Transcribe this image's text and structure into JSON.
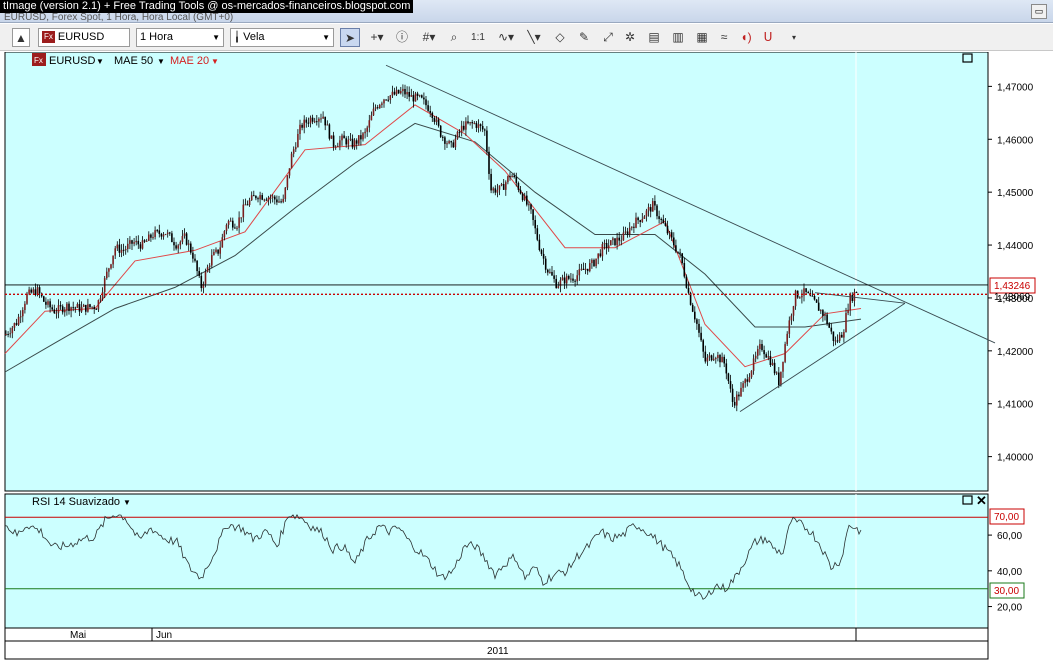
{
  "window": {
    "title": "tImage (version 2.1) + Free Trading Tools @ os-mercados-financeiros.blogspot.com",
    "subtitle": "EURUSD, Forex Spot, 1 Hora, Hora Local (GMT+0)"
  },
  "toolbar": {
    "symbol": "EURUSD",
    "interval": "1 Hora",
    "chart_type": "Vela",
    "badge": "Fx",
    "zoom_label": "1:1"
  },
  "price_panel": {
    "badge": "Fx",
    "legend": [
      {
        "label": "EURUSD",
        "color": "#000000"
      },
      {
        "label": "MAE 50",
        "color": "#000000"
      },
      {
        "label": "MAE 20",
        "color": "#d42020"
      }
    ],
    "last_price_label": "1,43246",
    "red_line_label": "1,43069",
    "colors": {
      "background": "#ccffff",
      "bull": "#7a1e1e",
      "bear": "#000000",
      "ema20": "#e04848",
      "ema50": "#3a4a4a",
      "resistance": "#c80000"
    }
  },
  "rsi_panel": {
    "title": "RSI 14 Suavizado",
    "upper_level_label": "70,00",
    "lower_level_label": "30,00"
  },
  "time_axis": {
    "months": [
      "Mai",
      "Jun"
    ],
    "year": "2011"
  },
  "chart_data": [
    {
      "type": "candlestick",
      "title": "EURUSD",
      "ylim": [
        1.3935,
        1.4765
      ],
      "yticks": [
        1.4,
        1.41,
        1.42,
        1.43,
        1.44,
        1.45,
        1.46,
        1.47
      ],
      "ytick_labels": [
        "1,40000",
        "1,41000",
        "1,42000",
        "1,43000",
        "1,44000",
        "1,45000",
        "1,46000",
        "1,47000"
      ],
      "grid": false,
      "legend_position": "top-left",
      "close_path": [
        [
          0,
          1.423
        ],
        [
          12,
          1.4255
        ],
        [
          22,
          1.4305
        ],
        [
          32,
          1.4315
        ],
        [
          40,
          1.429
        ],
        [
          50,
          1.4275
        ],
        [
          62,
          1.4285
        ],
        [
          76,
          1.428
        ],
        [
          92,
          1.4285
        ],
        [
          100,
          1.4335
        ],
        [
          110,
          1.4395
        ],
        [
          118,
          1.439
        ],
        [
          128,
          1.4405
        ],
        [
          138,
          1.44
        ],
        [
          148,
          1.442
        ],
        [
          160,
          1.4425
        ],
        [
          172,
          1.44
        ],
        [
          180,
          1.4415
        ],
        [
          188,
          1.438
        ],
        [
          196,
          1.432
        ],
        [
          206,
          1.4375
        ],
        [
          214,
          1.439
        ],
        [
          222,
          1.4445
        ],
        [
          232,
          1.444
        ],
        [
          240,
          1.4475
        ],
        [
          252,
          1.4495
        ],
        [
          266,
          1.449
        ],
        [
          278,
          1.448
        ],
        [
          286,
          1.4565
        ],
        [
          296,
          1.4625
        ],
        [
          306,
          1.464
        ],
        [
          318,
          1.4645
        ],
        [
          328,
          1.459
        ],
        [
          338,
          1.46
        ],
        [
          348,
          1.459
        ],
        [
          360,
          1.461
        ],
        [
          370,
          1.466
        ],
        [
          380,
          1.468
        ],
        [
          390,
          1.4685
        ],
        [
          398,
          1.469
        ],
        [
          406,
          1.468
        ],
        [
          416,
          1.4675
        ],
        [
          426,
          1.4655
        ],
        [
          436,
          1.461
        ],
        [
          446,
          1.4585
        ],
        [
          458,
          1.4625
        ],
        [
          470,
          1.463
        ],
        [
          480,
          1.4615
        ],
        [
          486,
          1.4505
        ],
        [
          496,
          1.4505
        ],
        [
          506,
          1.4535
        ],
        [
          516,
          1.45
        ],
        [
          526,
          1.446
        ],
        [
          534,
          1.44
        ],
        [
          542,
          1.4355
        ],
        [
          552,
          1.4325
        ],
        [
          560,
          1.4335
        ],
        [
          570,
          1.434
        ],
        [
          580,
          1.4355
        ],
        [
          588,
          1.4365
        ],
        [
          598,
          1.4395
        ],
        [
          608,
          1.4405
        ],
        [
          618,
          1.4415
        ],
        [
          628,
          1.444
        ],
        [
          638,
          1.4455
        ],
        [
          648,
          1.4475
        ],
        [
          658,
          1.444
        ],
        [
          668,
          1.4405
        ],
        [
          676,
          1.4375
        ],
        [
          684,
          1.4305
        ],
        [
          692,
          1.425
        ],
        [
          700,
          1.418
        ],
        [
          710,
          1.4195
        ],
        [
          720,
          1.4175
        ],
        [
          728,
          1.41
        ],
        [
          736,
          1.4125
        ],
        [
          746,
          1.4165
        ],
        [
          756,
          1.421
        ],
        [
          766,
          1.418
        ],
        [
          774,
          1.414
        ],
        [
          782,
          1.4235
        ],
        [
          790,
          1.4305
        ],
        [
          800,
          1.431
        ],
        [
          810,
          1.429
        ],
        [
          820,
          1.4265
        ],
        [
          830,
          1.4215
        ],
        [
          838,
          1.4235
        ],
        [
          844,
          1.4295
        ],
        [
          852,
          1.4315
        ]
      ],
      "ema20_path": [
        [
          0,
          1.4195
        ],
        [
          40,
          1.4275
        ],
        [
          90,
          1.428
        ],
        [
          130,
          1.437
        ],
        [
          190,
          1.439
        ],
        [
          240,
          1.4425
        ],
        [
          300,
          1.458
        ],
        [
          360,
          1.459
        ],
        [
          410,
          1.4665
        ],
        [
          460,
          1.461
        ],
        [
          500,
          1.454
        ],
        [
          560,
          1.4395
        ],
        [
          610,
          1.4395
        ],
        [
          660,
          1.4445
        ],
        [
          700,
          1.425
        ],
        [
          740,
          1.417
        ],
        [
          780,
          1.4195
        ],
        [
          820,
          1.427
        ],
        [
          856,
          1.428
        ]
      ],
      "ema50_path": [
        [
          0,
          1.416
        ],
        [
          50,
          1.4215
        ],
        [
          110,
          1.428
        ],
        [
          170,
          1.432
        ],
        [
          230,
          1.438
        ],
        [
          290,
          1.447
        ],
        [
          350,
          1.4555
        ],
        [
          410,
          1.463
        ],
        [
          470,
          1.4595
        ],
        [
          530,
          1.45
        ],
        [
          590,
          1.442
        ],
        [
          650,
          1.442
        ],
        [
          700,
          1.4345
        ],
        [
          750,
          1.4245
        ],
        [
          800,
          1.4245
        ],
        [
          856,
          1.426
        ]
      ],
      "trendlines": [
        {
          "from": [
            381,
            1.474
          ],
          "to": [
            990,
            1.4215
          ]
        },
        {
          "from": [
            735,
            1.4085
          ],
          "to": [
            900,
            1.429
          ]
        },
        {
          "from": [
            810,
            1.431
          ],
          "to": [
            900,
            1.429
          ]
        }
      ],
      "horizontal_lines": [
        1.43246,
        1.43069
      ]
    },
    {
      "type": "line",
      "title": "RSI 14 Suavizado",
      "ylim": [
        8,
        83
      ],
      "yticks": [
        20,
        40,
        60
      ],
      "ytick_labels": [
        "20,00",
        "40,00",
        "60,00"
      ],
      "levels": [
        70,
        30
      ],
      "path": [
        [
          0,
          66
        ],
        [
          12,
          60
        ],
        [
          22,
          66
        ],
        [
          36,
          62
        ],
        [
          48,
          53
        ],
        [
          62,
          54
        ],
        [
          78,
          58
        ],
        [
          90,
          59
        ],
        [
          100,
          68
        ],
        [
          110,
          72
        ],
        [
          120,
          70
        ],
        [
          134,
          57
        ],
        [
          146,
          64
        ],
        [
          160,
          58
        ],
        [
          172,
          56
        ],
        [
          184,
          42
        ],
        [
          196,
          36
        ],
        [
          210,
          51
        ],
        [
          222,
          66
        ],
        [
          236,
          64
        ],
        [
          248,
          58
        ],
        [
          262,
          62
        ],
        [
          272,
          54
        ],
        [
          284,
          72
        ],
        [
          296,
          70
        ],
        [
          306,
          65
        ],
        [
          318,
          61
        ],
        [
          328,
          52
        ],
        [
          338,
          54
        ],
        [
          350,
          44
        ],
        [
          362,
          57
        ],
        [
          374,
          65
        ],
        [
          384,
          62
        ],
        [
          394,
          64
        ],
        [
          406,
          55
        ],
        [
          416,
          50
        ],
        [
          426,
          44
        ],
        [
          436,
          36
        ],
        [
          448,
          40
        ],
        [
          460,
          54
        ],
        [
          470,
          54
        ],
        [
          480,
          47
        ],
        [
          490,
          38
        ],
        [
          500,
          44
        ],
        [
          510,
          48
        ],
        [
          520,
          36
        ],
        [
          530,
          42
        ],
        [
          538,
          34
        ],
        [
          550,
          38
        ],
        [
          562,
          40
        ],
        [
          572,
          48
        ],
        [
          584,
          54
        ],
        [
          596,
          62
        ],
        [
          606,
          58
        ],
        [
          618,
          60
        ],
        [
          630,
          66
        ],
        [
          642,
          62
        ],
        [
          654,
          56
        ],
        [
          664,
          50
        ],
        [
          674,
          43
        ],
        [
          684,
          32
        ],
        [
          692,
          26
        ],
        [
          700,
          24
        ],
        [
          710,
          32
        ],
        [
          720,
          30
        ],
        [
          730,
          36
        ],
        [
          740,
          46
        ],
        [
          750,
          56
        ],
        [
          760,
          58
        ],
        [
          770,
          52
        ],
        [
          778,
          50
        ],
        [
          786,
          68
        ],
        [
          796,
          66
        ],
        [
          806,
          62
        ],
        [
          816,
          54
        ],
        [
          826,
          42
        ],
        [
          836,
          46
        ],
        [
          844,
          66
        ],
        [
          856,
          62
        ]
      ],
      "xlabels": [
        "Mai",
        "Jun"
      ],
      "year_label": "2011"
    }
  ]
}
